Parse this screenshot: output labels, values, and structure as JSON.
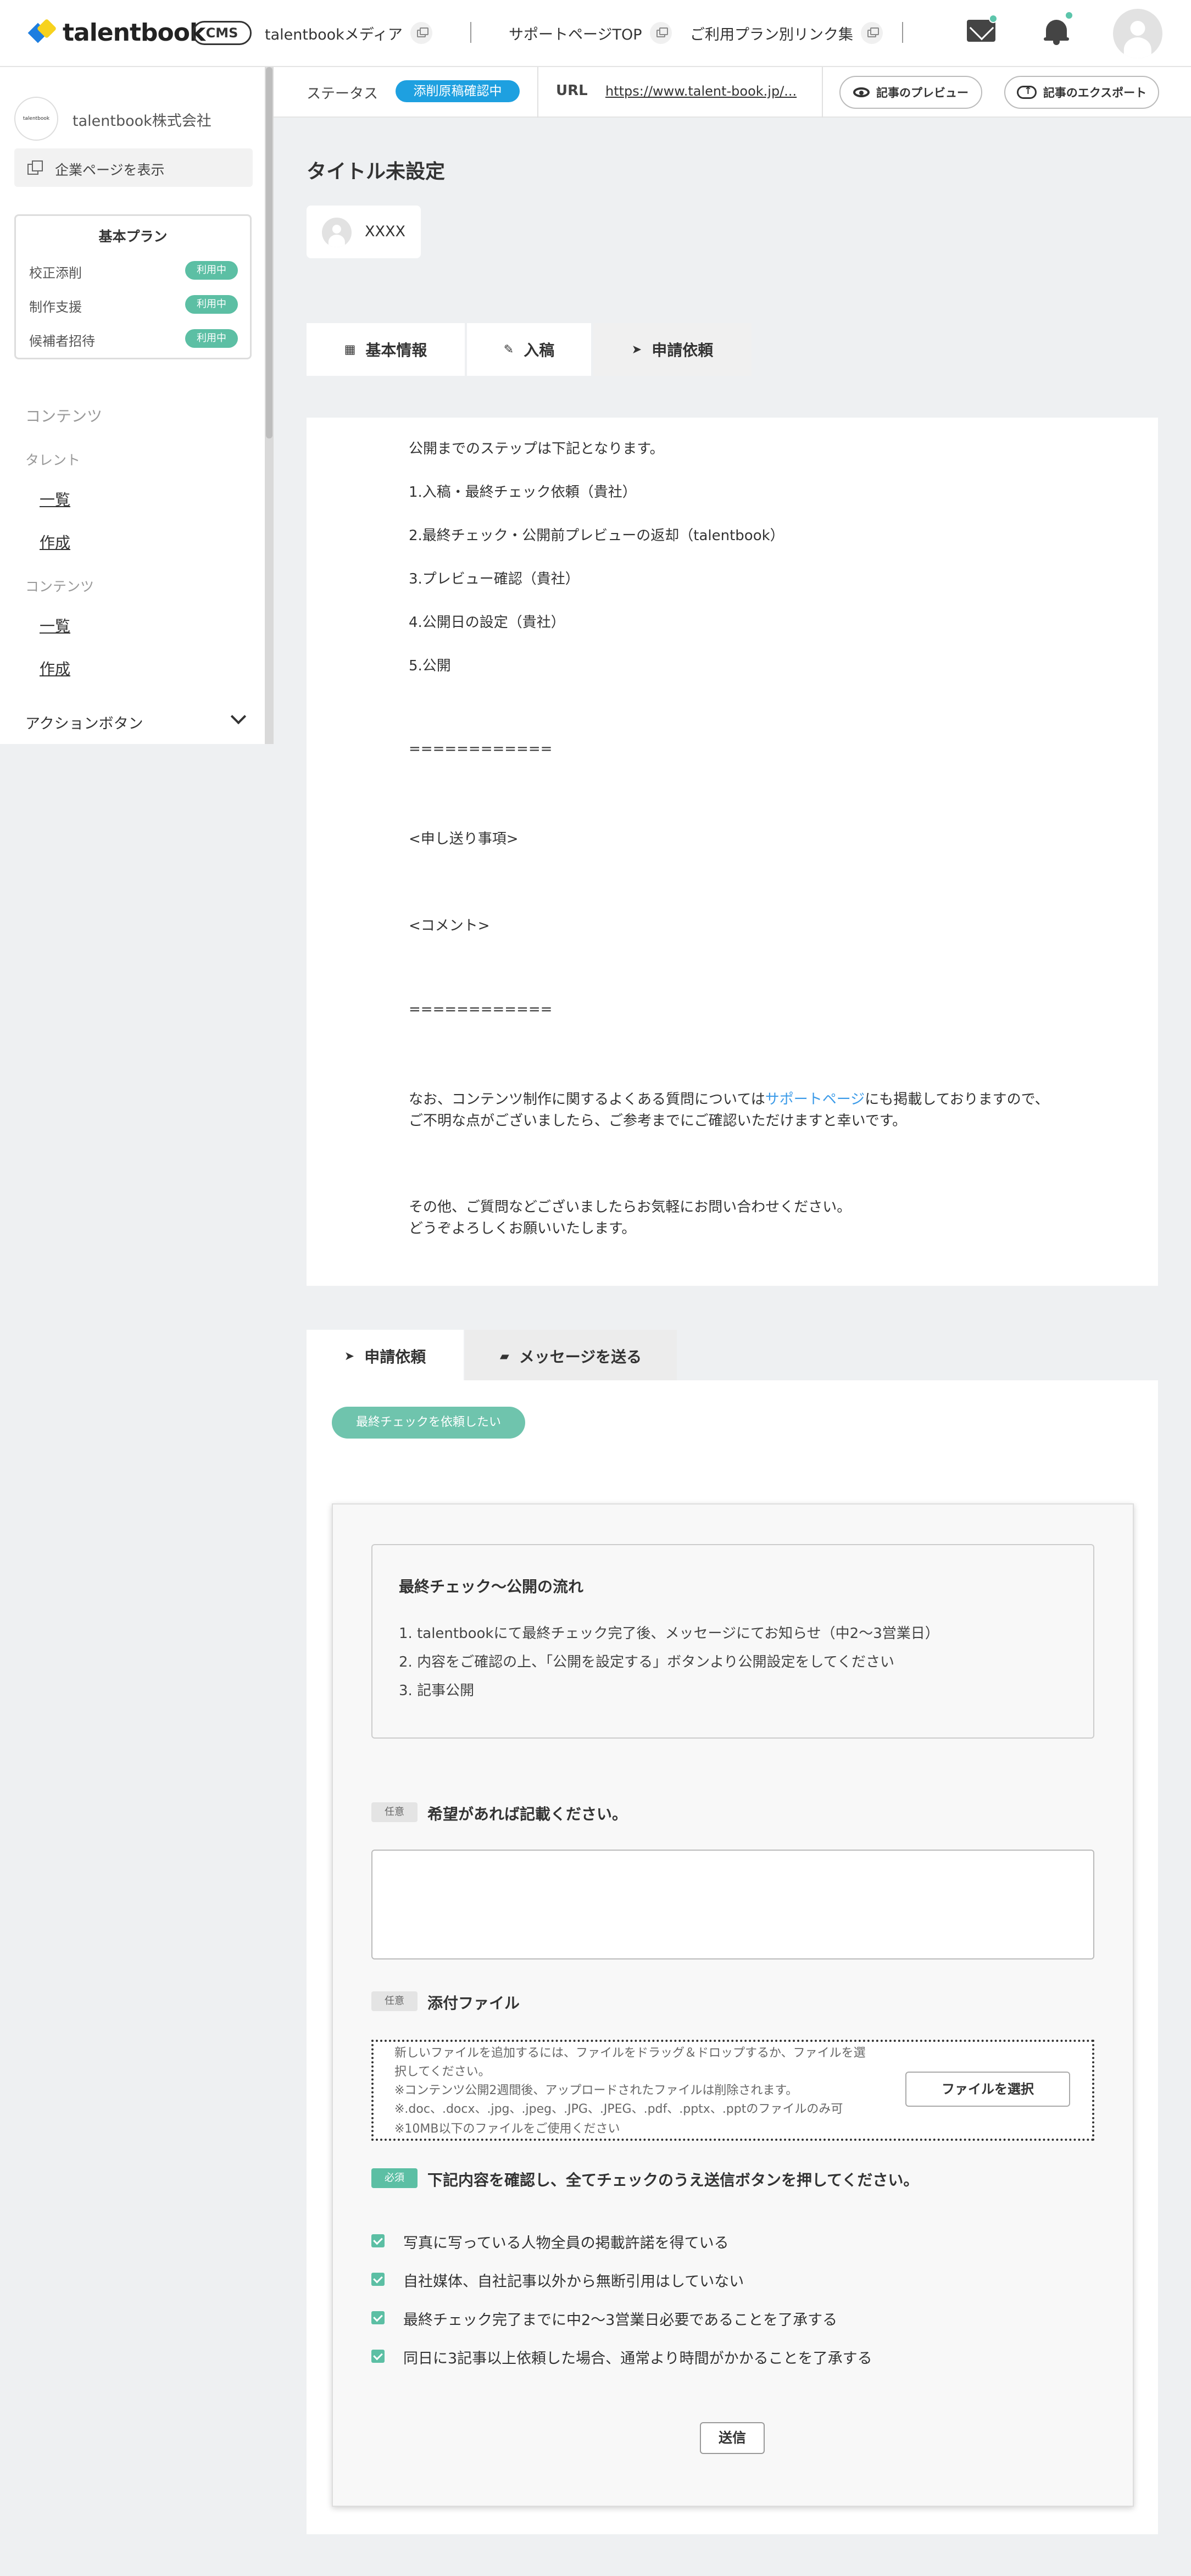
{
  "header": {
    "logo_text": "talentbook",
    "cms_badge": "CMS",
    "links": [
      "talentbookメディア",
      "サポートページTOP",
      "ご利用プラン別リンク集"
    ]
  },
  "sidebar": {
    "company_logo_text": "talentbook",
    "company_name": "talentbook株式会社",
    "view_company_page": "企業ページを表示",
    "plan": {
      "title": "基本プラン",
      "items": [
        {
          "label": "校正添削",
          "status": "利用中"
        },
        {
          "label": "制作支援",
          "status": "利用中"
        },
        {
          "label": "候補者招待",
          "status": "利用中"
        }
      ]
    },
    "section_contents": "コンテンツ",
    "talent_heading": "タレント",
    "talent_list": "一覧",
    "talent_create": "作成",
    "contents_heading": "コンテンツ",
    "contents_list": "一覧",
    "contents_create": "作成",
    "action_button": "アクションボタン"
  },
  "statusbar": {
    "status_label": "ステータス",
    "status_value": "添削原稿確認中",
    "url_label": "URL",
    "url_value": "https://www.talent-book.jp/...",
    "preview_button": "記事のプレビュー",
    "export_button": "記事のエクスポート"
  },
  "article": {
    "title": "タイトル未設定",
    "author": "XXXX"
  },
  "tabs": [
    "基本情報",
    "入稿",
    "申請依頼"
  ],
  "content": {
    "intro": "公開までのステップは下記となります。",
    "steps": [
      "1.入稿・最終チェック依頼（貴社）",
      "2.最終チェック・公開前プレビューの返却（talentbook）",
      "3.プレビュー確認（貴社）",
      "4.公開日の設定（貴社）",
      "5.公開"
    ],
    "divider": "============",
    "notes_heading": "<申し送り事項>",
    "comment_heading": "<コメント>",
    "faq_pre": "なお、コンテンツ制作に関するよくある質問については",
    "faq_link": "サポートページ",
    "faq_post": "にも掲載しておりますので、",
    "faq_line2": "ご不明な点がございましたら、ご参考までにご確認いただけますと幸いです。",
    "closing_1": "その他、ご質問などございましたらお気軽にお問い合わせください。",
    "closing_2": "どうぞよろしくお願いいたします。"
  },
  "lower_tabs": [
    "申請依頼",
    "メッセージを送る"
  ],
  "form": {
    "final_check_button": "最終チェックを依頼したい",
    "flow_title": "最終チェック〜公開の流れ",
    "flow_items": [
      "1. talentbookにて最終チェック完了後、メッセージにてお知らせ（中2〜3営業日）",
      "2. 内容をご確認の上、「公開を設定する」ボタンより公開設定をしてください",
      "3. 記事公開"
    ],
    "optional_badge": "任意",
    "required_badge": "必須",
    "request_label": "希望があれば記載ください。",
    "attach_label": "添付ファイル",
    "dropzone_lines": [
      "新しいファイルを追加するには、ファイルをドラッグ＆ドロップするか、ファイルを選",
      "択してください。",
      "※コンテンツ公開2週間後、アップロードされたファイルは削除されます。",
      "※.doc、.docx、.jpg、.jpeg、.JPG、.JPEG、.pdf、.pptx、.pptのファイルのみ可",
      "※10MB以下のファイルをご使用ください"
    ],
    "file_button": "ファイルを選択",
    "confirm_label": "下記内容を確認し、全てチェックのうえ送信ボタンを押してください。",
    "checks": [
      "写真に写っている人物全員の掲載許諾を得ている",
      "自社媒体、自社記事以外から無断引用はしていない",
      "最終チェック完了までに中2〜3営業日必要であることを了承する",
      "同日に3記事以上依頼した場合、通常より時間がかかることを了承する"
    ],
    "send_button": "送信"
  }
}
